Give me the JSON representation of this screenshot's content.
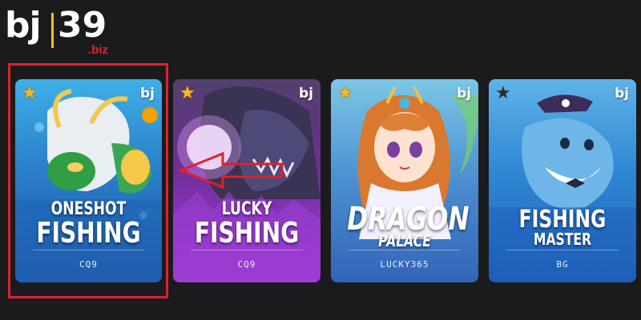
{
  "logo": {
    "brand": "bj",
    "number": "39",
    "tld": ".biz"
  },
  "colors": {
    "highlight": "#e0202a",
    "star_active": "#f4b826",
    "star_inactive": "#2b2b2b"
  },
  "cards": [
    {
      "title_line1": "ONESHOT",
      "title_line2": "FISHING",
      "provider": "CQ9",
      "brand_badge": "bj",
      "favorite": true,
      "highlighted": true,
      "icon": "dragon-art"
    },
    {
      "title_line1": "LUCKY",
      "title_line2": "FISHING",
      "provider": "CQ9",
      "brand_badge": "bj",
      "favorite": true,
      "highlighted": false,
      "icon": "sea-monster-art"
    },
    {
      "title_line1": "DRAGON",
      "title_line2": "PALACE",
      "provider": "LUCKY365",
      "brand_badge": "bj",
      "favorite": true,
      "highlighted": false,
      "icon": "princess-art"
    },
    {
      "title_line1": "FISHING",
      "title_line2": "MASTER",
      "provider": "BG",
      "brand_badge": "bj",
      "favorite": false,
      "highlighted": false,
      "icon": "shark-pirate-art"
    }
  ],
  "annotations": {
    "arrow_icon": "left-arrow-icon"
  }
}
